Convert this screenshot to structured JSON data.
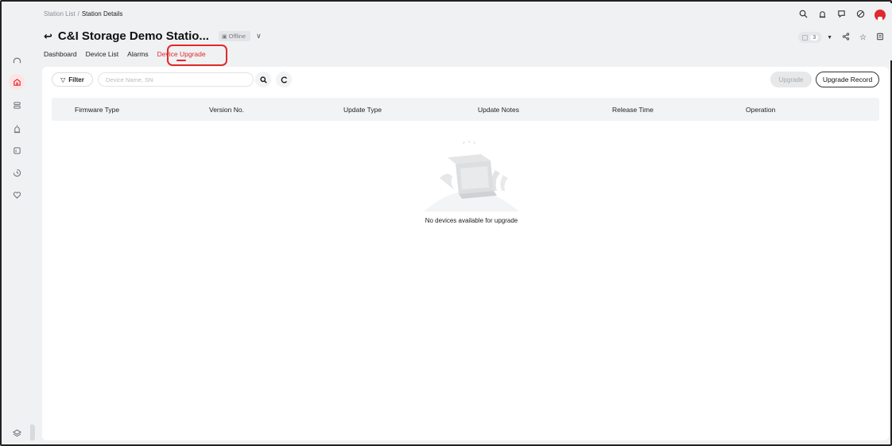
{
  "breadcrumb": {
    "parent": "Station List",
    "separator": "/",
    "current": "Station Details"
  },
  "station": {
    "title": "C&I Storage Demo Statio...",
    "status": "Offline"
  },
  "tabs": [
    {
      "label": "Dashboard"
    },
    {
      "label": "Device List"
    },
    {
      "label": "Alarms"
    },
    {
      "label": "Device Upgrade"
    }
  ],
  "toolbar": {
    "counter": "3"
  },
  "filters": {
    "filter_label": "Filter",
    "search_placeholder": "Device Name, SN"
  },
  "actions": {
    "upgrade_label": "Upgrade",
    "record_label": "Upgrade Record"
  },
  "table": {
    "columns": [
      "Firmware Type",
      "Version No.",
      "Update Type",
      "Update Notes",
      "Release Time",
      "Operation"
    ],
    "rows": []
  },
  "empty_state": {
    "message": "No devices available for upgrade"
  },
  "colors": {
    "accent": "#e0292b",
    "page_bg": "#f0f1f3",
    "card_bg": "#ffffff",
    "header_bg": "#f2f3f5"
  }
}
